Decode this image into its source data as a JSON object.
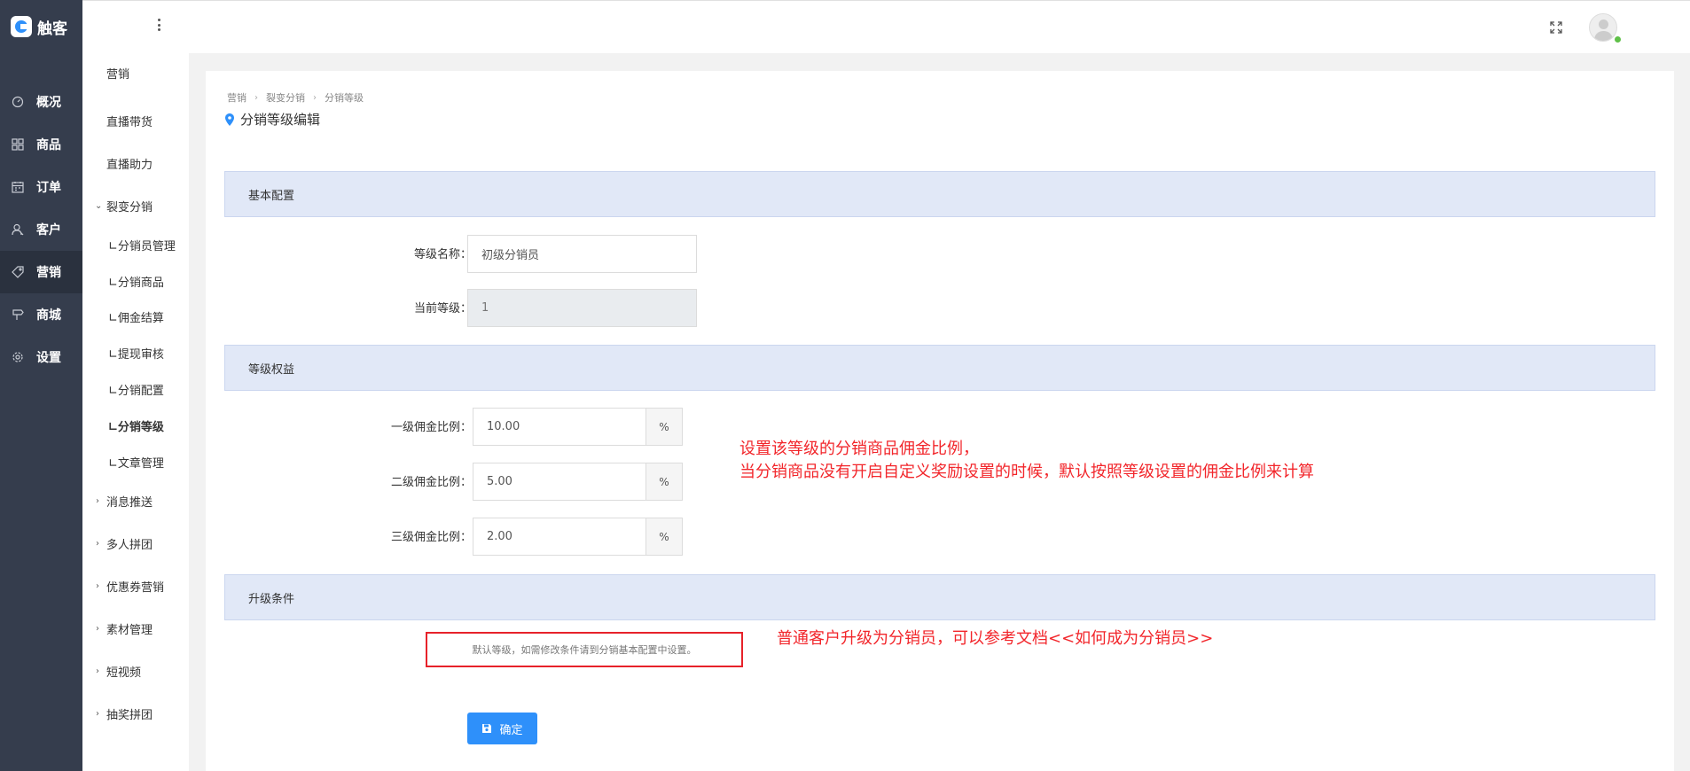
{
  "app": {
    "logo_text": "触客"
  },
  "nav": {
    "items": [
      {
        "label": "概况",
        "icon": "dashboard-icon"
      },
      {
        "label": "商品",
        "icon": "grid-icon"
      },
      {
        "label": "订单",
        "icon": "calendar-icon"
      },
      {
        "label": "客户",
        "icon": "user-icon"
      },
      {
        "label": "营销",
        "icon": "tag-icon"
      },
      {
        "label": "商城",
        "icon": "signpost-icon"
      },
      {
        "label": "设置",
        "icon": "gear-icon"
      }
    ],
    "active": "营销"
  },
  "subnav": {
    "items": [
      "营销",
      "直播带货",
      "直播助力",
      "裂变分销",
      "∟分销员管理",
      "∟分销商品",
      "∟佣金结算",
      "∟提现审核",
      "∟分销配置",
      "∟分销等级",
      "∟文章管理",
      "消息推送",
      "多人拼团",
      "优惠券营销",
      "素材管理",
      "短视频",
      "抽奖拼团"
    ],
    "active": "∟分销等级"
  },
  "breadcrumb": [
    "营销",
    "裂变分销",
    "分销等级"
  ],
  "page_title": "分销等级编辑",
  "sections": {
    "basic": "基本配置",
    "benefits": "等级权益",
    "upgrade": "升级条件"
  },
  "form": {
    "level_name": {
      "label": "等级名称：",
      "value": "初级分销员"
    },
    "current_level": {
      "label": "当前等级：",
      "value": "1"
    },
    "commission_1": {
      "label": "一级佣金比例：",
      "value": "10.00",
      "unit": "%"
    },
    "commission_2": {
      "label": "二级佣金比例：",
      "value": "5.00",
      "unit": "%"
    },
    "commission_3": {
      "label": "三级佣金比例：",
      "value": "2.00",
      "unit": "%"
    },
    "upgrade_text": "默认等级，如需修改条件请到分销基本配置中设置。"
  },
  "annotations": {
    "commission_line1": "设置该等级的分销商品佣金比例，",
    "commission_line2": "当分销商品没有开启自定义奖励设置的时候，默认按照等级设置的佣金比例来计算",
    "upgrade_note": "普通客户升级为分销员，可以参考文档<<如何成为分销员>>"
  },
  "submit_label": "确定",
  "colors": {
    "primary": "#2e90fa",
    "sidebar": "#353d4d",
    "annotation": "#f2262b"
  }
}
